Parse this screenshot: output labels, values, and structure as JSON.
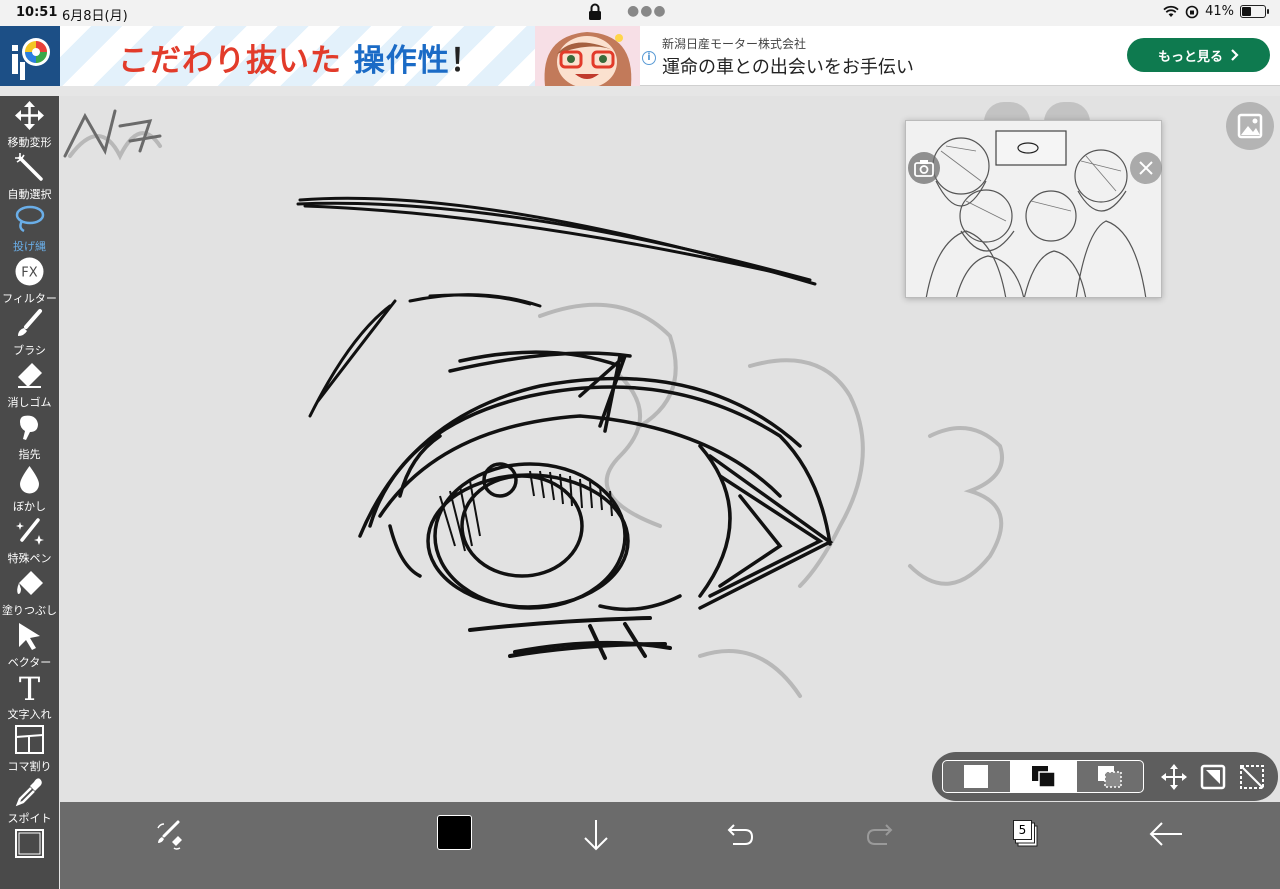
{
  "status_bar": {
    "time": "10:51",
    "date": "6月8日(月)",
    "battery": "41%",
    "battery_level": 0.41
  },
  "ad": {
    "headline_part1": "こだわり抜いた",
    "headline_part2": "操作性",
    "headline_part3": "！",
    "company": "新潟日産モーター株式会社",
    "tagline": "運命の車との出会いをお手伝い",
    "cta_label": "もっと見る",
    "info_glyph": "i",
    "colors": {
      "headline_red": "#e23b2a",
      "headline_blue": "#1b6bc6",
      "cta_green": "#0e7a4f"
    }
  },
  "toolbar": {
    "tools": [
      {
        "id": "move",
        "label": "移動変形",
        "icon": "move-icon"
      },
      {
        "id": "magic-wand",
        "label": "自動選択",
        "icon": "magic-wand-icon"
      },
      {
        "id": "lasso",
        "label": "投げ縄",
        "icon": "lasso-icon",
        "active": true
      },
      {
        "id": "filter",
        "label": "フィルター",
        "icon": "fx-icon"
      },
      {
        "id": "brush",
        "label": "ブラシ",
        "icon": "brush-icon"
      },
      {
        "id": "eraser",
        "label": "消しゴム",
        "icon": "eraser-icon"
      },
      {
        "id": "smudge",
        "label": "指先",
        "icon": "smudge-icon"
      },
      {
        "id": "blur",
        "label": "ぼかし",
        "icon": "drop-icon"
      },
      {
        "id": "special-pen",
        "label": "特殊ペン",
        "icon": "special-pen-icon"
      },
      {
        "id": "fill",
        "label": "塗りつぶし",
        "icon": "bucket-icon"
      },
      {
        "id": "vector",
        "label": "ベクター",
        "icon": "cursor-icon"
      },
      {
        "id": "text",
        "label": "文字入れ",
        "icon": "text-icon"
      },
      {
        "id": "frame",
        "label": "コマ割り",
        "icon": "frame-icon"
      },
      {
        "id": "eyedropper",
        "label": "スポイト",
        "icon": "eyedropper-icon"
      }
    ],
    "fx_glyph": "FX",
    "text_glyph": "T",
    "active_color": "#6aaee8"
  },
  "bottom_bar": {
    "layer_count": "5",
    "current_color": "#000000",
    "buttons": [
      "brush-swap-icon",
      "color-swatch",
      "download-icon",
      "undo-icon",
      "redo-icon",
      "layers-icon",
      "back-arrow-icon"
    ]
  },
  "selection_panel": {
    "modes": [
      "new-selection-icon",
      "add-selection-icon",
      "subtract-selection-icon"
    ],
    "active_mode": 1,
    "extras": [
      "move-selection-icon",
      "invert-selection-icon",
      "clear-selection-icon"
    ]
  }
}
